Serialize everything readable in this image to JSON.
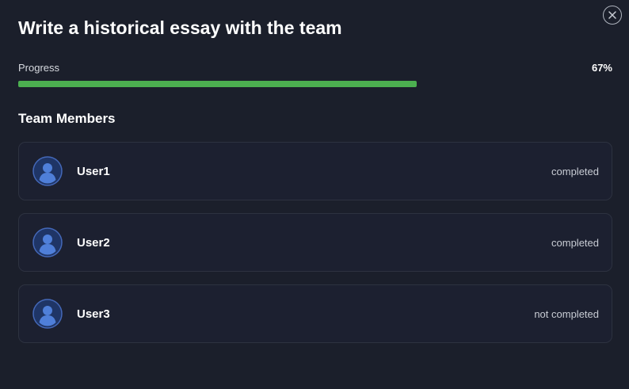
{
  "modal": {
    "title": "Write a historical essay with the team",
    "close_icon": "close-icon"
  },
  "progress": {
    "label": "Progress",
    "value_text": "67%",
    "fraction": 0.67,
    "color": "#4caf50"
  },
  "team": {
    "heading": "Team Members",
    "members": [
      {
        "name": "User1",
        "status": "completed",
        "avatar_icon": "user-avatar-icon"
      },
      {
        "name": "User2",
        "status": "completed",
        "avatar_icon": "user-avatar-icon"
      },
      {
        "name": "User3",
        "status": "not completed",
        "avatar_icon": "user-avatar-icon"
      }
    ]
  }
}
